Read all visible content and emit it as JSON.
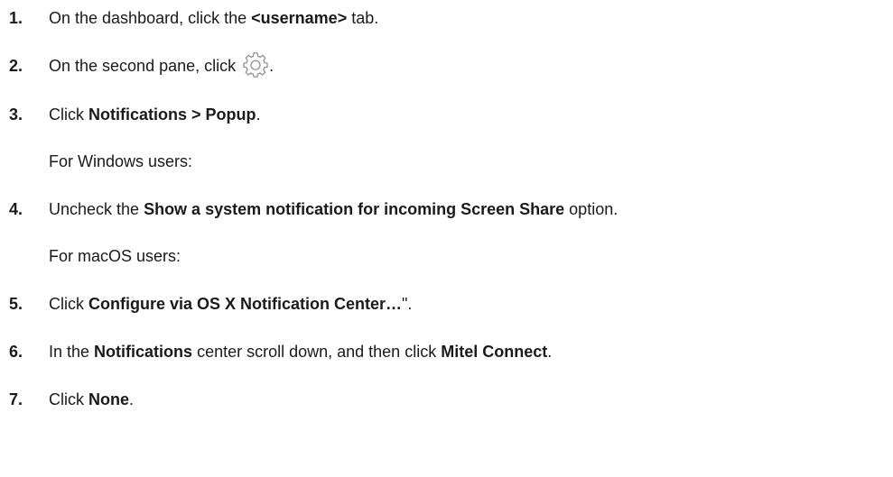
{
  "steps": [
    {
      "number": "1.",
      "before": "On the dashboard, click the ",
      "bold": "<username>",
      "after": " tab."
    },
    {
      "number": "2.",
      "before": "On the second pane, click ",
      "icon": "gear-icon",
      "after": "."
    },
    {
      "number": "3.",
      "before": "Click ",
      "bold": "Notifications > Popup",
      "after": "."
    },
    {
      "note": "For Windows users:"
    },
    {
      "number": "4.",
      "before": "Uncheck the ",
      "bold": "Show a system notification for incoming Screen Share",
      "after": " option."
    },
    {
      "note": "For macOS users:"
    },
    {
      "number": "5.",
      "before": "Click ",
      "bold": "Configure via OS X Notification Center…",
      "after": "\"."
    },
    {
      "number": "6.",
      "before": "In the ",
      "bold": "Notifications",
      "middle": " center scroll down, and then click ",
      "bold2": "Mitel Connect",
      "after": "."
    },
    {
      "number": "7.",
      "before": "Click ",
      "bold": "None",
      "after": "."
    }
  ],
  "colors": {
    "text": "#1a1a1a",
    "icon_stroke": "#8a8a8a",
    "background": "#ffffff"
  }
}
